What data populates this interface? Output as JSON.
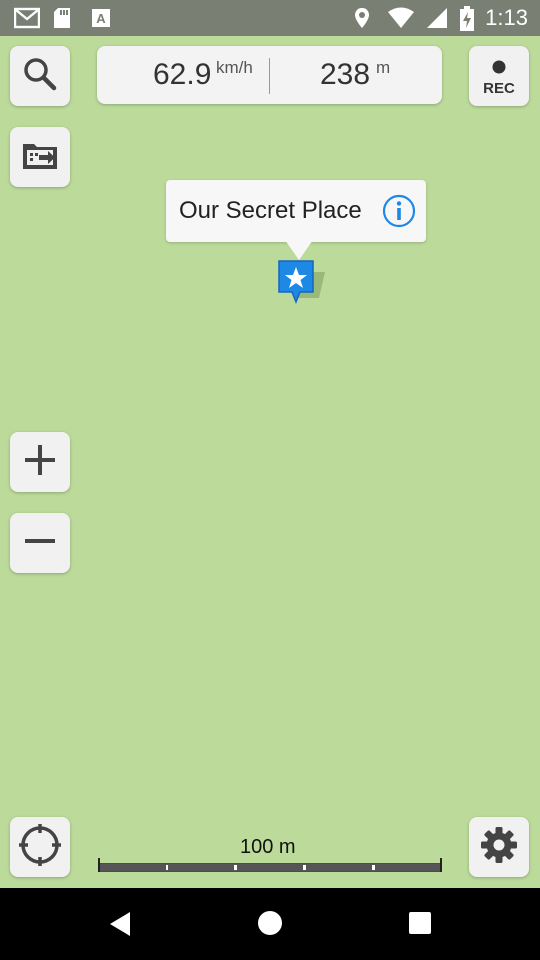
{
  "status_bar": {
    "time": "1:13",
    "left_icons": [
      "gmail-icon",
      "sd-card-icon",
      "font-a-icon"
    ],
    "right_icons": [
      "location-pin-icon",
      "wifi-icon",
      "cell-signal-icon",
      "battery-charging-icon"
    ]
  },
  "speed_panel": {
    "speed": "62.9",
    "speed_unit": "km/h",
    "altitude": "238",
    "altitude_unit": "m"
  },
  "rec_button": {
    "label": "REC"
  },
  "callout": {
    "title": "Our Secret Place"
  },
  "scale": {
    "label": "100 m"
  },
  "colors": {
    "map": "#bcdb9a",
    "button_bg": "#f1f1f1",
    "accent_blue": "#1e88e5",
    "status_bar": "#7a7f74"
  }
}
